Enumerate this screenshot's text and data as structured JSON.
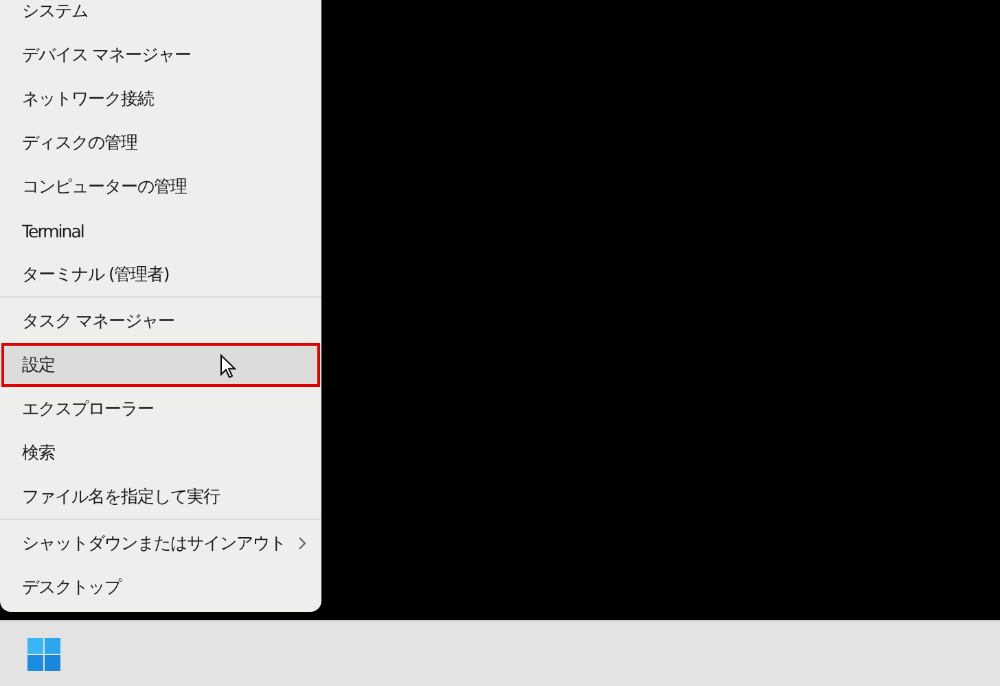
{
  "menu": {
    "groups": [
      {
        "items": [
          {
            "label": "システム",
            "selected": false,
            "has_submenu": false
          },
          {
            "label": "デバイス マネージャー",
            "selected": false,
            "has_submenu": false
          },
          {
            "label": "ネットワーク接続",
            "selected": false,
            "has_submenu": false
          },
          {
            "label": "ディスクの管理",
            "selected": false,
            "has_submenu": false
          },
          {
            "label": "コンピューターの管理",
            "selected": false,
            "has_submenu": false
          },
          {
            "label": "Terminal",
            "selected": false,
            "has_submenu": false
          },
          {
            "label": "ターミナル (管理者)",
            "selected": false,
            "has_submenu": false
          }
        ]
      },
      {
        "items": [
          {
            "label": "タスク マネージャー",
            "selected": false,
            "has_submenu": false
          },
          {
            "label": "設定",
            "selected": true,
            "has_submenu": false
          },
          {
            "label": "エクスプローラー",
            "selected": false,
            "has_submenu": false
          },
          {
            "label": "検索",
            "selected": false,
            "has_submenu": false
          },
          {
            "label": "ファイル名を指定して実行",
            "selected": false,
            "has_submenu": false
          }
        ]
      },
      {
        "items": [
          {
            "label": "シャットダウンまたはサインアウト",
            "selected": false,
            "has_submenu": true
          },
          {
            "label": "デスクトップ",
            "selected": false,
            "has_submenu": false
          }
        ]
      }
    ]
  }
}
